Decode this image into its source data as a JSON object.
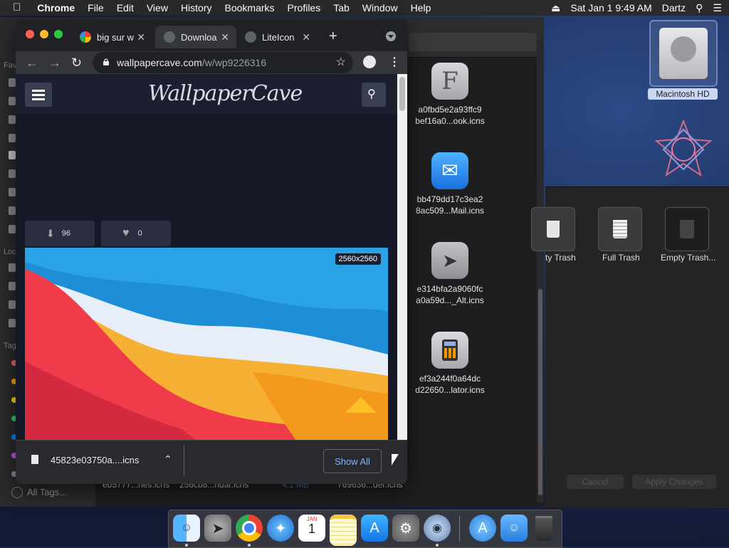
{
  "menubar": {
    "app": "Chrome",
    "menus": [
      "File",
      "Edit",
      "View",
      "History",
      "Bookmarks",
      "Profiles",
      "Tab",
      "Window",
      "Help"
    ],
    "clock": "Sat Jan 1  9:49 AM",
    "user": "Dartz"
  },
  "chrome": {
    "tabs": [
      {
        "title": "big sur w",
        "active": false
      },
      {
        "title": "Downloa",
        "active": true
      },
      {
        "title": "LiteIcon",
        "active": false
      }
    ],
    "url_host": "wallpapercave.com",
    "url_path": "/w/wp9226316",
    "site": {
      "logo": "WallpaperCave",
      "downloads": "96",
      "likes": "0",
      "resolution": "2560x2560"
    },
    "download": {
      "filename": "45823e03750a....icns",
      "show_all": "Show All"
    }
  },
  "finder": {
    "files": [
      {
        "line1": "a0fbd5e2a93ffc9",
        "line2": "bef16a0...ook.icns",
        "icon": "font-book-icon"
      },
      {
        "line1": "bb479dd17c3ea2",
        "line2": "8ac509...Mail.icns",
        "icon": "mail-icon"
      },
      {
        "line1": "e314bfa2a9060fc",
        "line2": "a0a59d..._Alt.icns",
        "icon": "launchpad-icon"
      },
      {
        "line1": "ef3a244f0a64dc",
        "line2": "d22650...lator.icns",
        "icon": "calculator-icon"
      }
    ],
    "bottom_files": [
      "eb5777...nes.icns",
      "256cb8...ndar.icns",
      "4.1 MB",
      "769636...der.icns"
    ],
    "sidebar_labels": [
      "Fav",
      "Loc",
      "Tag"
    ],
    "all_tags": "All Tags...",
    "tag_colors": [
      "#ff5f57",
      "#ff9f0a",
      "#ffd60a",
      "#30d158",
      "#0a84ff",
      "#bf5af2",
      "#8e8e93"
    ]
  },
  "trash_panel": {
    "labels": [
      "ty Trash",
      "Full Trash",
      "Empty Trash..."
    ],
    "cancel": "Cancel",
    "apply": "Apply Changes"
  },
  "desktop": {
    "hd_label": "Macintosh HD"
  },
  "dock": {
    "apps": [
      "finder-icon",
      "launchpad-icon",
      "chrome-icon",
      "safari-icon",
      "calendar-icon",
      "notes-icon",
      "app-store-icon",
      "system-preferences-icon",
      "liteicon-icon",
      "app-store-downloads-icon",
      "finder-folder-icon",
      "trash-icon"
    ],
    "calendar_month": "JAN",
    "calendar_day": "1"
  }
}
